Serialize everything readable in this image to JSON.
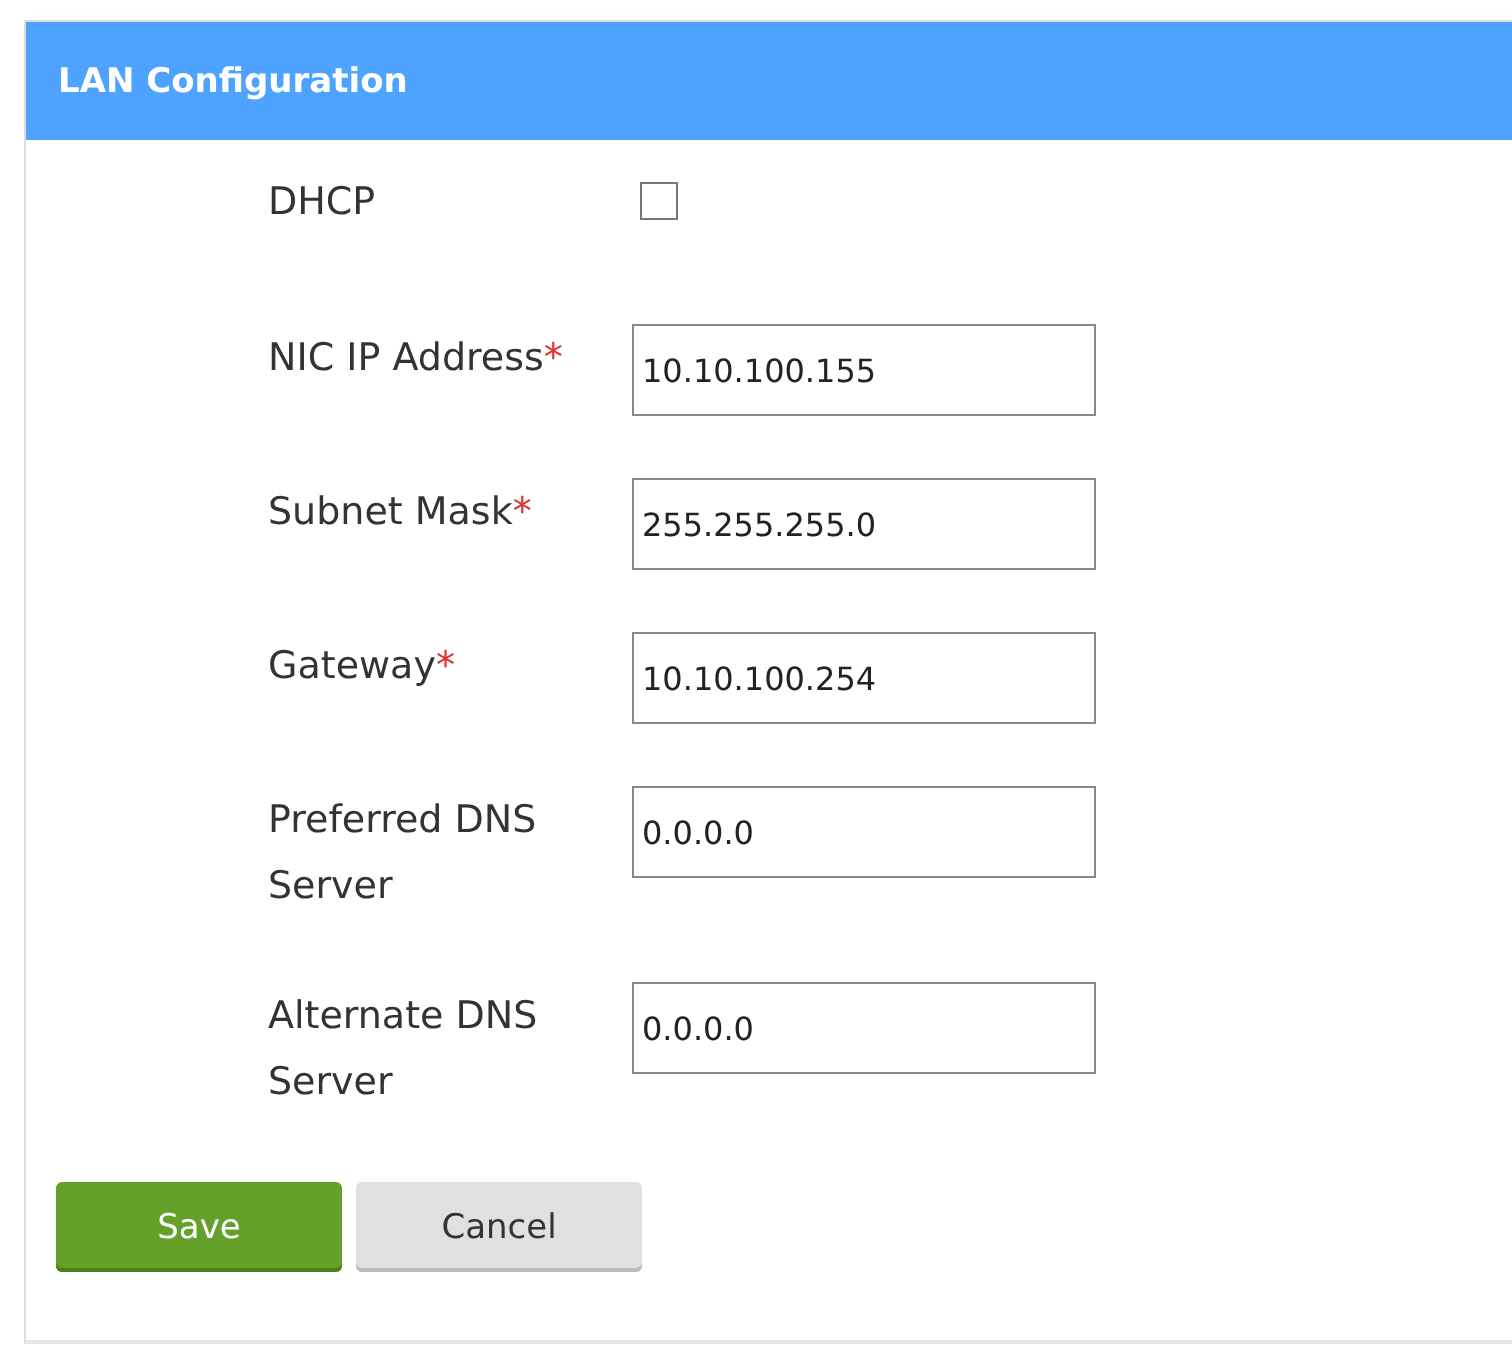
{
  "panel": {
    "title": "LAN Configuration"
  },
  "fields": [
    {
      "kind": "checkbox",
      "label": "DHCP",
      "checked": false
    },
    {
      "kind": "text",
      "label": "NIC IP Address",
      "required_mark": "*",
      "value": "10.10.100.155"
    },
    {
      "kind": "text",
      "label": "Subnet Mask",
      "required_mark": "*",
      "value": "255.255.255.0"
    },
    {
      "kind": "text",
      "label": "Gateway",
      "required_mark": "*",
      "value": "10.10.100.254"
    },
    {
      "kind": "text",
      "label": "Preferred DNS Server",
      "value": "0.0.0.0"
    },
    {
      "kind": "text",
      "label": "Alternate DNS Server",
      "value": "0.0.0.0"
    }
  ],
  "buttons": [
    {
      "label": "Save",
      "kind": "primary"
    },
    {
      "label": "Cancel",
      "kind": "secondary"
    }
  ]
}
